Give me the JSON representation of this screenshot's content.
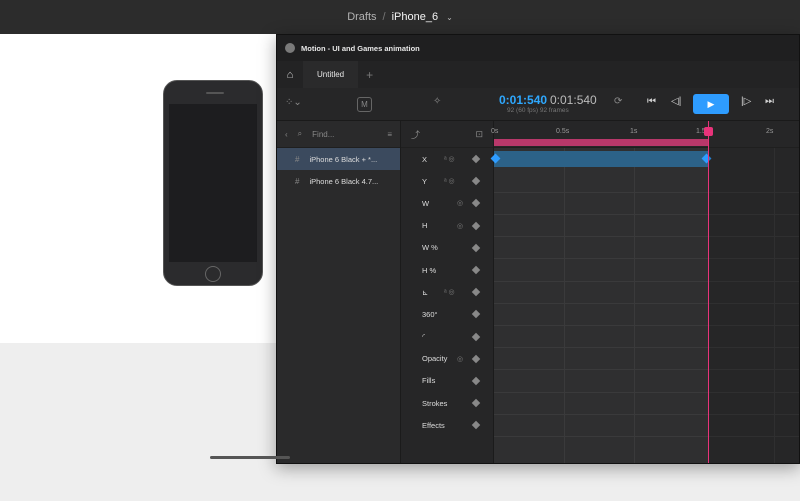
{
  "header": {
    "breadcrumb_root": "Drafts",
    "separator": "/",
    "file_name": "iPhone_6",
    "chevron": "⌄"
  },
  "plugin": {
    "title": "Motion - UI and Games animation",
    "tabs": [
      {
        "label": "Untitled"
      }
    ],
    "add_tab": "+",
    "toolbar": {
      "m_button": "M",
      "current_time": "0:01:540",
      "total_time": "0:01:540",
      "fps_info": "92 (60 fps) 92 frames"
    },
    "layers": {
      "search_placeholder": "Find...",
      "items": [
        {
          "label": "iPhone 6 Black + *...",
          "selected": true
        },
        {
          "label": "iPhone 6 Black 4.7...",
          "selected": false
        }
      ]
    },
    "properties": [
      {
        "label": "X"
      },
      {
        "label": "Y"
      },
      {
        "label": "W"
      },
      {
        "label": "H"
      },
      {
        "label": "W %"
      },
      {
        "label": "H %"
      },
      {
        "label": ""
      },
      {
        "label": "360°"
      },
      {
        "label": ""
      },
      {
        "label": "Opacity"
      },
      {
        "label": "Fills"
      },
      {
        "label": "Strokes"
      },
      {
        "label": "Effects"
      }
    ],
    "timeline": {
      "ticks": [
        "0s",
        "0.5s",
        "1s",
        "1.5",
        "2s"
      ],
      "playhead_time": "1.54s",
      "accent_color": "#2e9cff",
      "playhead_color": "#e8337a"
    }
  }
}
